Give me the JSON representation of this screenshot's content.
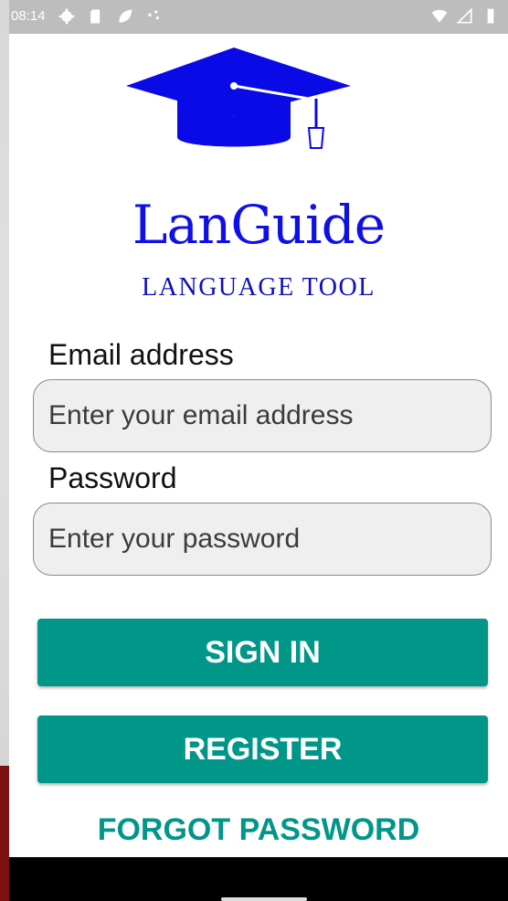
{
  "status_bar": {
    "time": "08:14",
    "left_icons": [
      "settings-icon",
      "sd-card-icon",
      "leaf-icon",
      "dots-icon"
    ],
    "right_icons": [
      "wifi-icon",
      "signal-icon",
      "battery-icon"
    ]
  },
  "brand": {
    "logo_icon": "graduation-cap-icon",
    "title": "LanGuide",
    "subtitle": "LANGUAGE TOOL",
    "color": "#1010e6"
  },
  "form": {
    "email_label": "Email address",
    "email_placeholder": "Enter your email address",
    "email_value": "",
    "password_label": "Password",
    "password_placeholder": "Enter your password",
    "password_value": ""
  },
  "actions": {
    "sign_in_label": "SIGN IN",
    "register_label": "REGISTER",
    "forgot_label": "FORGOT PASSWORD",
    "accent_color": "#009688"
  }
}
